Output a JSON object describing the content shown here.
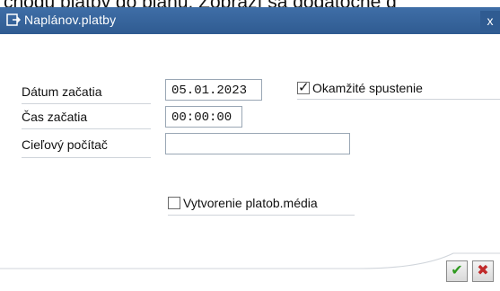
{
  "background_text": "chodu platby do plánu. Zobrazí sa dodatočné d",
  "window": {
    "title": "Naplánov.platby",
    "close_symbol": "x"
  },
  "form": {
    "start_date_label": "Dátum začatia",
    "start_date_value": "05.01.2023",
    "start_time_label": "Čas začatia",
    "start_time_value": "00:00:00",
    "target_computer_label": "Cieľový počítač",
    "target_computer_value": "",
    "immediate_start_label": "Okamžité spustenie",
    "immediate_start_checked": true,
    "create_payment_media_label": "Vytvorenie platob.média",
    "create_payment_media_checked": false
  },
  "buttons": {
    "ok_symbol": "✔",
    "cancel_symbol": "✖"
  },
  "colors": {
    "titlebar": "#3f6ea7",
    "ok": "#2f9a1f",
    "cancel": "#c02a2a"
  }
}
